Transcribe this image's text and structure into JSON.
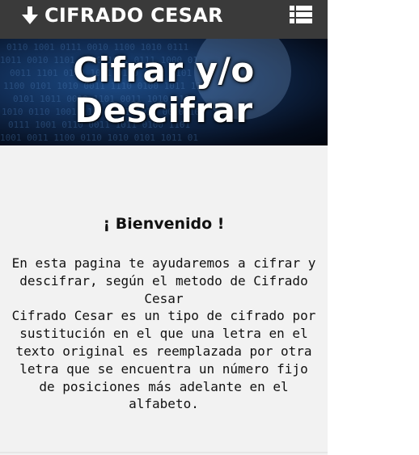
{
  "header": {
    "brand_label": "CIFRADO CESAR",
    "brand_icon": "arrow-down-icon",
    "menu_icon": "list-menu-icon",
    "background_color": "#3a3a3a"
  },
  "hero": {
    "title_line1": "Cifrar y/o",
    "title_line2": "Descifrar"
  },
  "main": {
    "welcome_heading": "¡ Bienvenido !",
    "intro_paragraph": "En esta pagina te ayudaremos a cifrar y descifrar, según el metodo de Cifrado Cesar",
    "description_paragraph": "Cifrado Cesar es un tipo de cifrado por sustitución en el que una letra en el texto original es reemplazada por otra letra que se encuentra un número fijo de posiciones más adelante en el alfabeto."
  }
}
